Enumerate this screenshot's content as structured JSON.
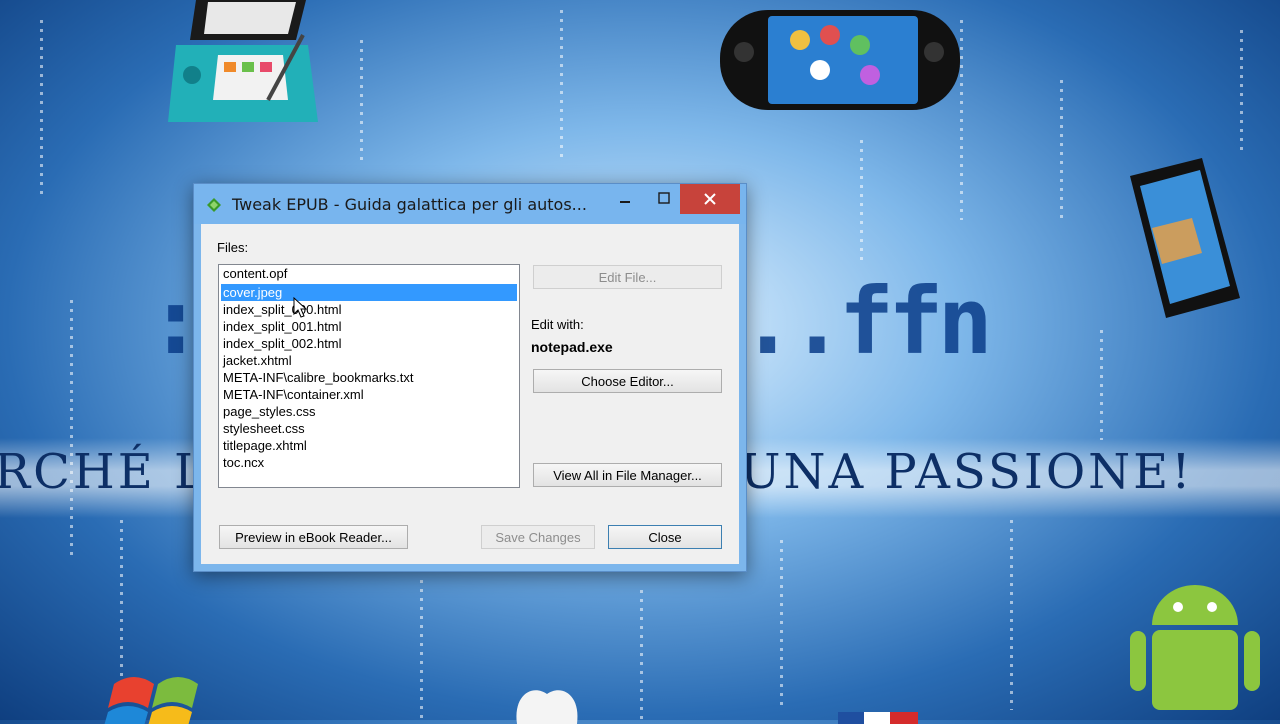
{
  "wallpaper": {
    "banner_left": "RCHÉ L",
    "banner_right": "UNA PASSIONE!",
    "dot_logo_left": "::.",
    "dot_logo_right": "..ffn"
  },
  "window": {
    "title": "Tweak EPUB - Guida galattica per gli autos...",
    "files_label": "Files:",
    "files": [
      "content.opf",
      "cover.jpeg",
      "index_split_000.html",
      "index_split_001.html",
      "index_split_002.html",
      "jacket.xhtml",
      "META-INF\\calibre_bookmarks.txt",
      "META-INF\\container.xml",
      "page_styles.css",
      "stylesheet.css",
      "titlepage.xhtml",
      "toc.ncx"
    ],
    "selected_file": "cover.jpeg",
    "edit_file_label": "Edit File...",
    "edit_with_label": "Edit with:",
    "editor_name": "notepad.exe",
    "choose_editor_label": "Choose Editor...",
    "view_all_label": "View All in File Manager...",
    "preview_label": "Preview in eBook Reader...",
    "save_label": "Save Changes",
    "close_label": "Close"
  },
  "colors": {
    "titlebar": "#78b5ee",
    "selection": "#3399ff",
    "close_button": "#c7433b"
  },
  "icons": {
    "app": "calibre-icon",
    "minimize": "minimize-icon",
    "maximize": "maximize-icon",
    "close": "close-icon"
  }
}
